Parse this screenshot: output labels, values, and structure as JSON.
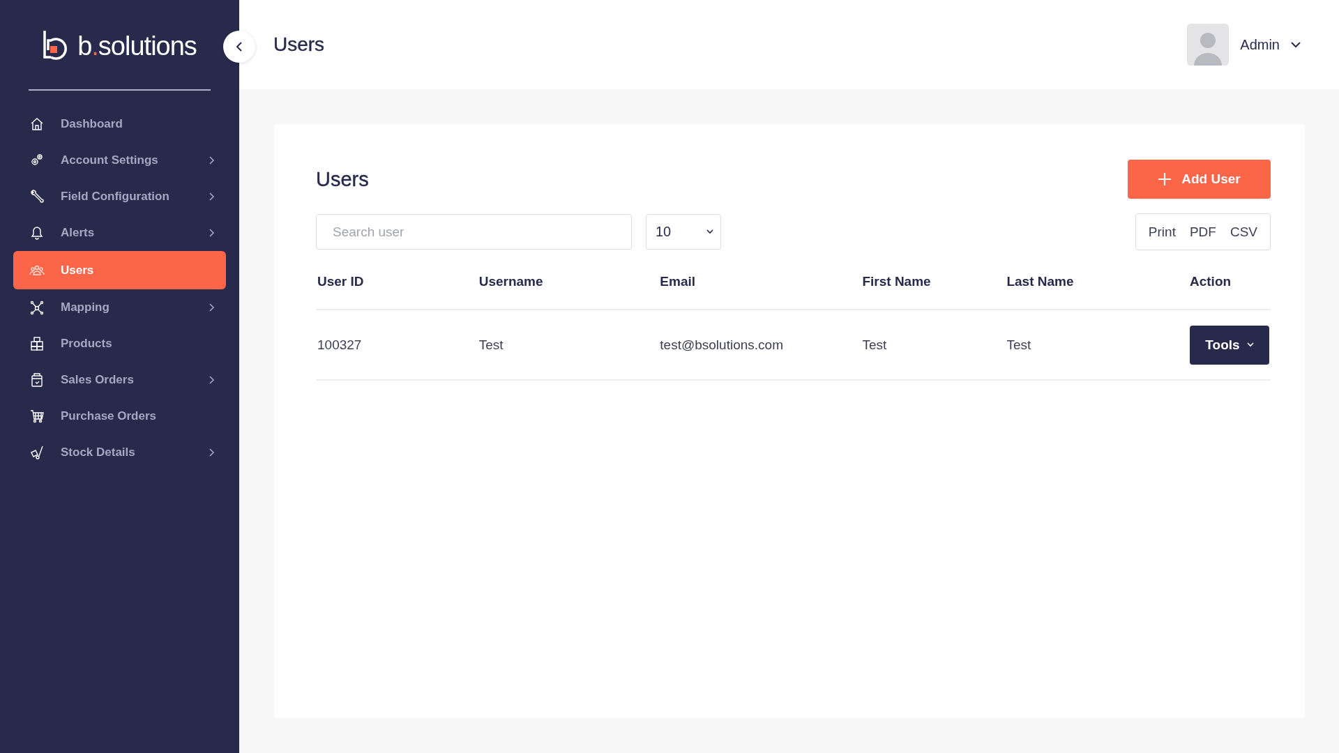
{
  "logo": {
    "letter": "b",
    "dot": ".",
    "rest": "solutions"
  },
  "sidebar": {
    "items": [
      {
        "label": "Dashboard",
        "has_submenu": false,
        "selected": false
      },
      {
        "label": "Account Settings",
        "has_submenu": true,
        "selected": false
      },
      {
        "label": "Field Configuration",
        "has_submenu": true,
        "selected": false
      },
      {
        "label": "Alerts",
        "has_submenu": true,
        "selected": false
      },
      {
        "label": "Users",
        "has_submenu": false,
        "selected": true
      },
      {
        "label": "Mapping",
        "has_submenu": true,
        "selected": false
      },
      {
        "label": "Products",
        "has_submenu": false,
        "selected": false
      },
      {
        "label": "Sales Orders",
        "has_submenu": true,
        "selected": false
      },
      {
        "label": "Purchase Orders",
        "has_submenu": false,
        "selected": false
      },
      {
        "label": "Stock Details",
        "has_submenu": true,
        "selected": false
      }
    ]
  },
  "header": {
    "title": "Users",
    "user": "Admin"
  },
  "card": {
    "title": "Users",
    "add_button": "Add User",
    "search": {
      "placeholder": "Search user"
    },
    "page_size": "10",
    "exports": [
      "Print",
      "PDF",
      "CSV"
    ],
    "table": {
      "columns": [
        "User ID",
        "Username",
        "Email",
        "First Name",
        "Last Name",
        "Action"
      ],
      "rows": [
        {
          "cells": [
            "100327",
            "Test",
            "test@bsolutions.com",
            "Test",
            "Test"
          ],
          "action": "Tools"
        }
      ]
    }
  }
}
